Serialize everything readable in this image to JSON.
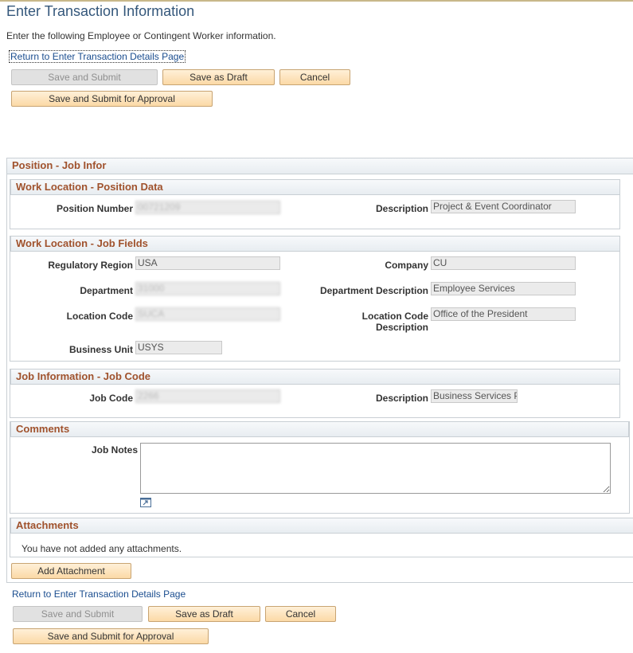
{
  "page": {
    "title": "Enter Transaction Information",
    "instructions": "Enter the following Employee or Contingent Worker information.",
    "return_link": "Return to Enter Transaction Details Page"
  },
  "actions": {
    "save_submit": "Save and Submit",
    "save_draft": "Save as Draft",
    "cancel": "Cancel",
    "save_submit_approval": "Save and Submit for Approval"
  },
  "position": {
    "header": "Position - Job Infor",
    "position_data": {
      "header": "Work Location - Position Data",
      "position_number_label": "Position Number",
      "position_number": "00721209",
      "description_label": "Description",
      "description": "Project & Event Coordinator"
    },
    "job_fields": {
      "header": "Work Location - Job Fields",
      "regulatory_region_label": "Regulatory Region",
      "regulatory_region": "USA",
      "company_label": "Company",
      "company": "CU",
      "department_label": "Department",
      "department": "31000",
      "department_description_label": "Department Description",
      "department_description": "Employee Services",
      "location_code_label": "Location Code",
      "location_code": "SUCA",
      "location_code_desc_label_1": "Location Code",
      "location_code_desc_label_2": "Description",
      "location_code_description": "Office of the President",
      "business_unit_label": "Business Unit",
      "business_unit": "USYS"
    },
    "job_code": {
      "header": "Job Information - Job Code",
      "job_code_label": "Job Code",
      "job_code": "2266",
      "description_label": "Description",
      "description": "Business Services P"
    }
  },
  "comments": {
    "header": "Comments",
    "job_notes_label": "Job Notes",
    "job_notes_value": ""
  },
  "attachments": {
    "header": "Attachments",
    "empty_message": "You have not added any attachments.",
    "add_button": "Add Attachment"
  }
}
